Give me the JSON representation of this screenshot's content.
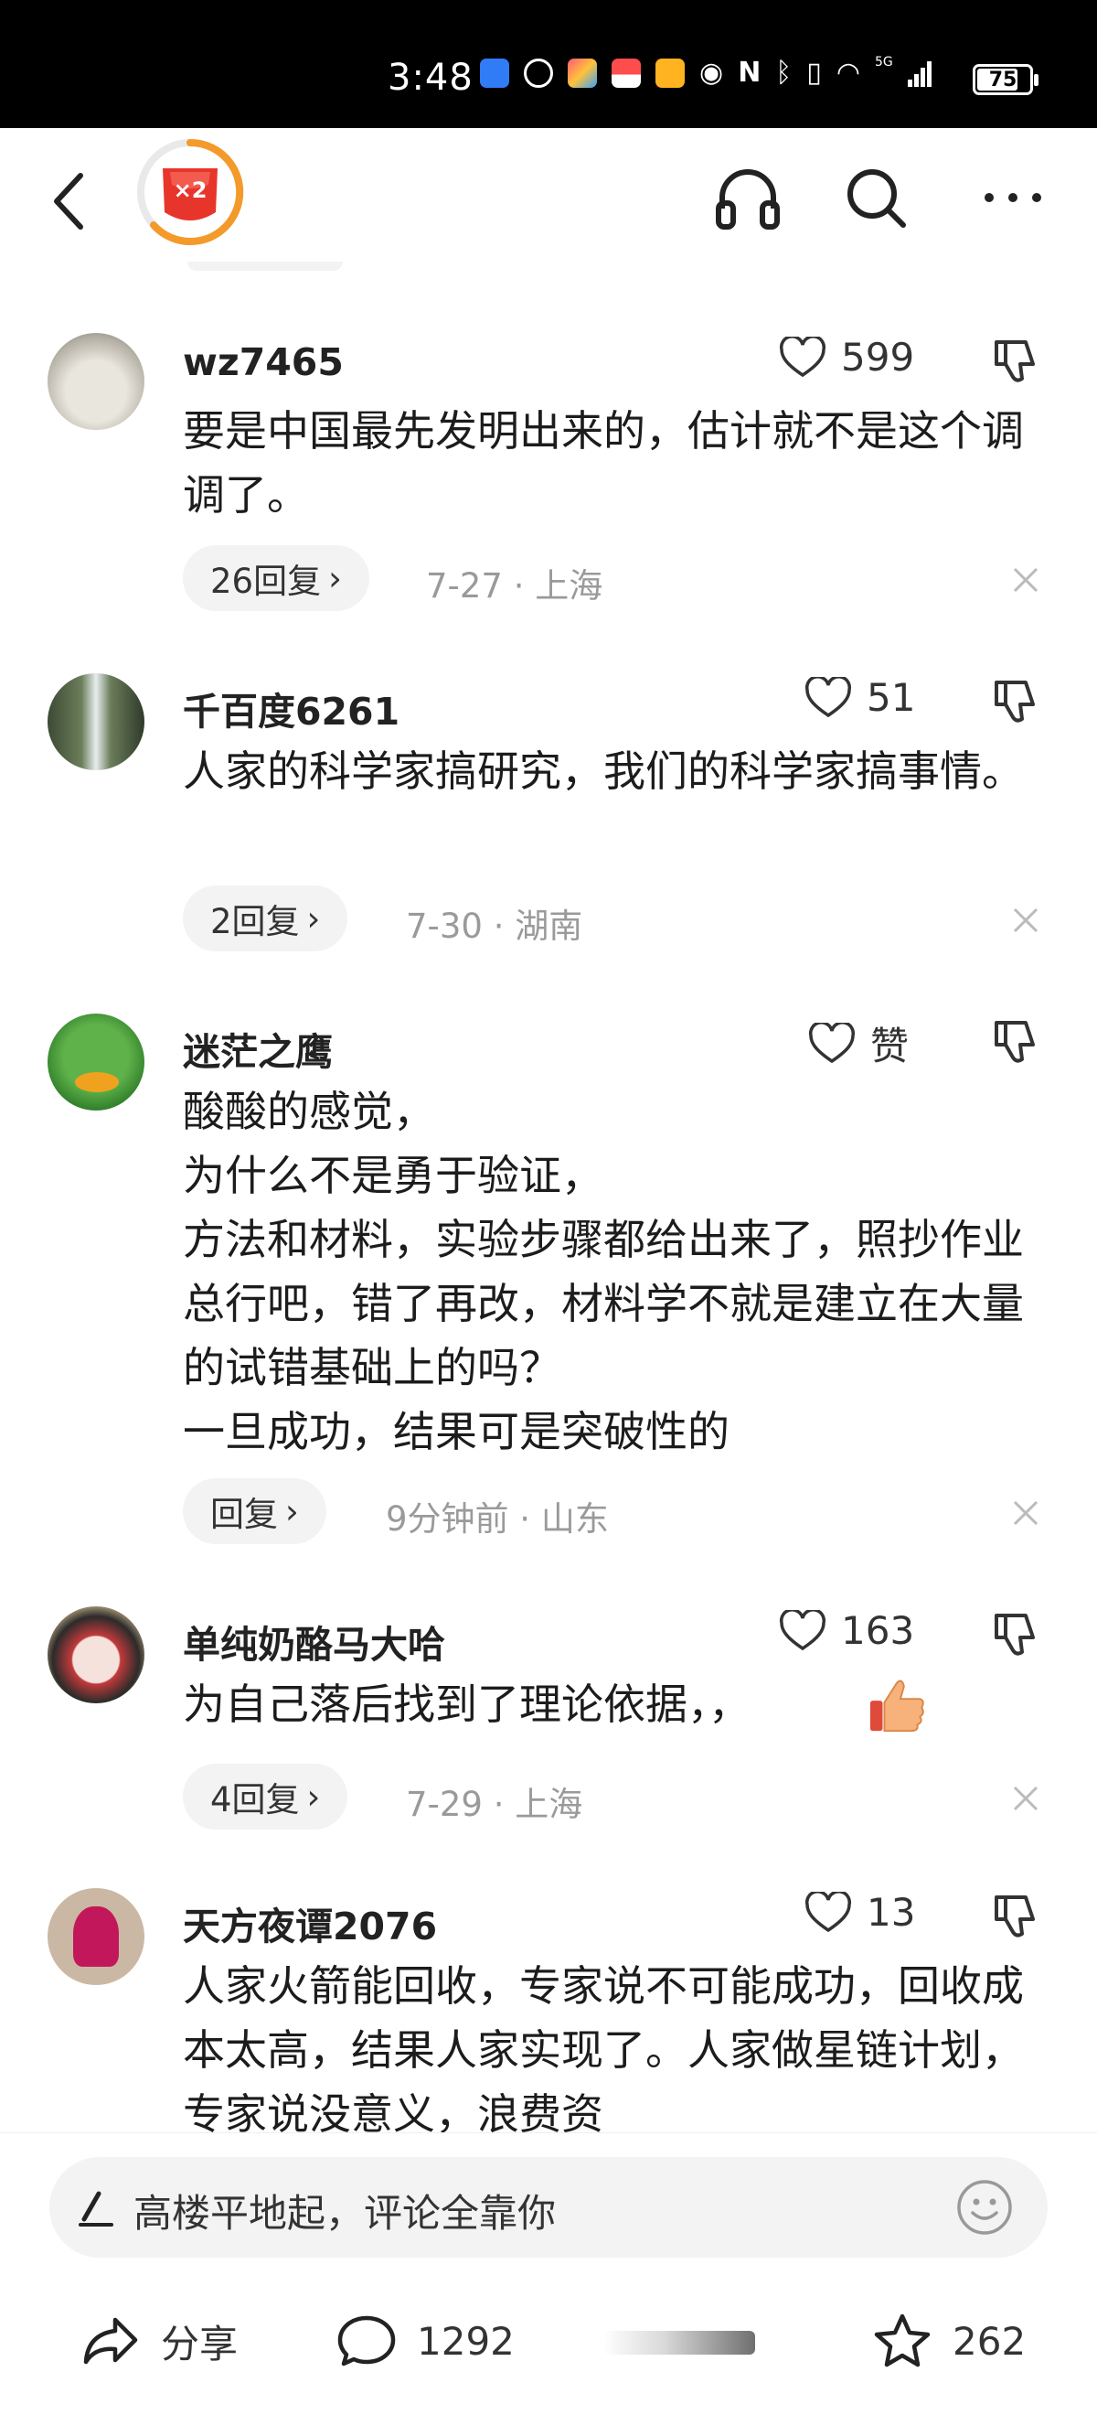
{
  "status_bar": {
    "time": "3:48",
    "icons": [
      "cloud-icon",
      "hand-icon",
      "app-icon",
      "gift-icon",
      "heart-app-icon",
      "eye-icon",
      "nfc-icon",
      "bluetooth-icon",
      "vibrate-icon",
      "wifi-icon",
      "5g-signal-icon"
    ],
    "network": "5G",
    "battery": "75"
  },
  "header": {
    "badge_text": "×2"
  },
  "comments": [
    {
      "name": "wz7465",
      "likes": "599",
      "text": "要是中国最先发明出来的，估计就不是这个调调了。",
      "replies": "26回复",
      "date": "7-27",
      "location": "上海"
    },
    {
      "name": "千百度6261",
      "likes": "51",
      "text": "人家的科学家搞研究，我们的科学家搞事情。",
      "replies": "2回复",
      "date": "7-30",
      "location": "湖南"
    },
    {
      "name": "迷茫之鹰",
      "likes": "赞",
      "text": "酸酸的感觉，\n为什么不是勇于验证，\n方法和材料，实验步骤都给出来了，照抄作业总行吧，错了再改，材料学不就是建立在大量的试错基础上的吗？\n一旦成功，结果可是突破性的",
      "replies": "回复",
      "date": "9分钟前",
      "location": "山东"
    },
    {
      "name": "单纯奶酪马大哈",
      "likes": "163",
      "text": "为自己落后找到了理论依据，，",
      "replies": "4回复",
      "date": "7-29",
      "location": "上海"
    },
    {
      "name": "天方夜谭2076",
      "likes": "13",
      "text": "人家火箭能回收，专家说不可能成功，回收成本太高，结果人家实现了。人家做星链计划，专家说没意义，浪费资",
      "replies": "",
      "date": "",
      "location": ""
    }
  ],
  "bottom": {
    "input_placeholder": "高楼平地起，评论全靠你",
    "share_label": "分享",
    "comment_count": "1292",
    "favorite_count": "262"
  },
  "colors": {
    "accent_red": "#e8352c",
    "accent_orange": "#f39a2b",
    "meta_gray": "#9a9a9a"
  }
}
